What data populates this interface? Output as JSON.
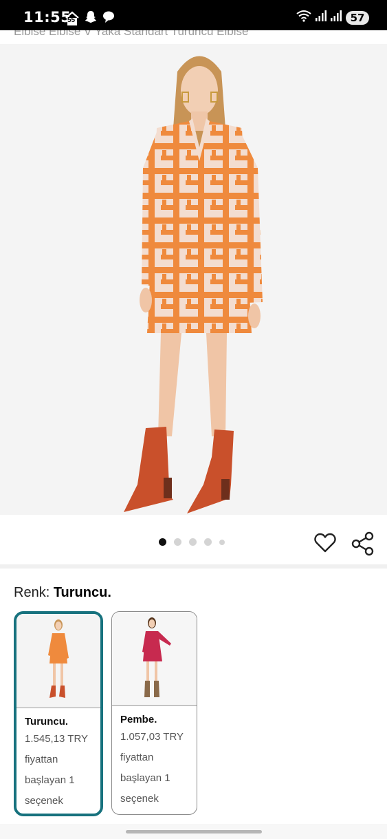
{
  "status_bar": {
    "time": "11:55",
    "notification_badge": "55",
    "battery": "57"
  },
  "product": {
    "title_peek": "Elbise Elbise V Yaka Standart Turuncu Elbise"
  },
  "carousel": {
    "image_count": 5,
    "active_index": 0
  },
  "color_selector": {
    "label": "Renk:",
    "selected": "Turuncu.",
    "variants": [
      {
        "name": "Turuncu.",
        "price": "1.545,13 TRY",
        "line1": "fiyattan",
        "line2": "başlayan 1",
        "line3": "seçenek",
        "selected": true,
        "dress_color": "#ef8a3d"
      },
      {
        "name": "Pembe.",
        "price": "1.057,03 TRY",
        "line1": "fiyattan",
        "line2": "başlayan 1",
        "line3": "seçenek",
        "selected": false,
        "dress_color": "#c72a4f"
      }
    ]
  },
  "colors": {
    "accent": "#17727e",
    "dress": "#ef8a3d",
    "boots": "#c9502b"
  },
  "icons": {
    "favorite": "heart-icon",
    "share": "share-icon"
  }
}
